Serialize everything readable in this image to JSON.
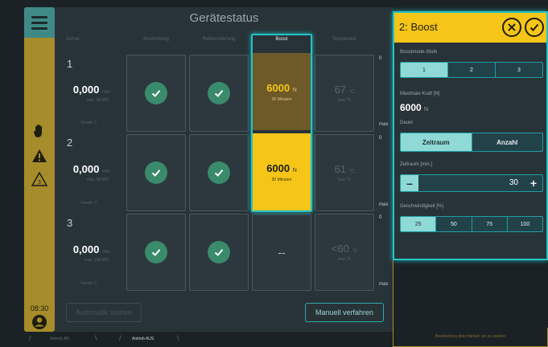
{
  "header": {
    "title": "Gerätestatus"
  },
  "columns": [
    "Achse",
    "Ausrichtung",
    "Referenzierung",
    "Boost",
    "Temperatur"
  ],
  "rows": [
    {
      "id": "1",
      "value": "0,000",
      "unit": "mm",
      "sub": "max. 50.000",
      "sensor": "Sender 1",
      "boost_value": "6000",
      "boost_unit": "N",
      "boost_sub": "30 Minuten",
      "temp_value": "67",
      "temp_unit": "°C",
      "temp_sub": "max 75"
    },
    {
      "id": "2",
      "value": "0,000",
      "unit": "mm",
      "sub": "max. 50.000",
      "sensor": "Sender 2",
      "boost_value": "6000",
      "boost_unit": "N",
      "boost_sub": "30 Minuten",
      "temp_value": "61",
      "temp_unit": "°C",
      "temp_sub": "max 75"
    },
    {
      "id": "3",
      "value": "0,000",
      "unit": "mm",
      "sub": "max. 100.000",
      "sensor": "Sender 1",
      "boost_value": "--",
      "temp_value": "<60",
      "temp_unit": "°C",
      "temp_sub": "max 75"
    }
  ],
  "scale": {
    "top": "0",
    "bottom": "max"
  },
  "buttons": {
    "auto": "Automatik starten",
    "manual": "Manuell verfahren"
  },
  "statusbar": {
    "drive_on": "Antrieb AN",
    "drive_off": "Antrieb AUS"
  },
  "rail": {
    "time": "08:30"
  },
  "panel": {
    "title": "2: Boost",
    "boost_level_label": "Boostmode-Stufe",
    "boost_levels": [
      "1",
      "2",
      "3"
    ],
    "boost_level_selected": "1",
    "max_force_label": "Maximale Kraft [N]",
    "max_force_value": "6000",
    "max_force_unit": "N",
    "duration_label": "Dauer",
    "duration_options": [
      "Zeitraum",
      "Anzahl"
    ],
    "duration_selected": "Zeitraum",
    "period_label": "Zeitraum [min.]",
    "period_value": "30",
    "speed_label": "Geschwindigkeit [%]",
    "speed_options": [
      "25",
      "50",
      "75",
      "100"
    ],
    "speed_selected": "25",
    "footer_hint": "Bearbeitung abschließen um zu starten"
  },
  "colors": {
    "accent": "#22c3c8",
    "boost_active": "#f5c518",
    "rail": "#a68c2a",
    "check": "#3a8a6c"
  }
}
